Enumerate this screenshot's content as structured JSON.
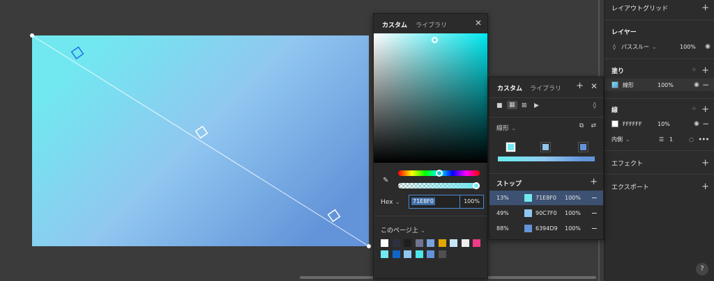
{
  "canvas": {
    "gradient": {
      "from": "#71E8F0",
      "mid": "#90C7F0",
      "to": "#6394D9"
    }
  },
  "right_panel": {
    "layout_grid": {
      "title": "レイアウトグリッド"
    },
    "layer": {
      "title": "レイヤー",
      "blend_mode": "パススルー",
      "opacity": "100%"
    },
    "fill": {
      "title": "塗り",
      "type": "線形",
      "opacity": "100%"
    },
    "stroke": {
      "title": "線",
      "hex": "FFFFFF",
      "opacity": "10%",
      "position": "内側",
      "weight": "1"
    },
    "effects": {
      "title": "エフェクト"
    },
    "export": {
      "title": "エクスポート"
    },
    "help": "?"
  },
  "color_picker": {
    "tabs": [
      "カスタム",
      "ライブラリ"
    ],
    "close_icon": "close-icon",
    "hex_label": "Hex",
    "hex_value": "71E8F0",
    "alpha": "100%",
    "page_colors_label": "このページ上",
    "swatches": [
      "#ffffff",
      "#2e3040",
      "#1e1e1e",
      "#6f7590",
      "#7aa3dc",
      "#e0a800",
      "#c7e6f5",
      "#eeeeee",
      "#f03a8a",
      "#71e8f0",
      "#1066c8",
      "#90c7f0",
      "#4de6ea",
      "#6394d9",
      "#505050"
    ]
  },
  "gradient_panel": {
    "tabs": [
      "カスタム",
      "ライブラリ"
    ],
    "gradient_type": "線形",
    "stops_label": "ストップ",
    "stops": [
      {
        "position": "13%",
        "hex": "71E8F0",
        "opacity": "100%",
        "color": "#71E8F0"
      },
      {
        "position": "49%",
        "hex": "90C7F0",
        "opacity": "100%",
        "color": "#90C7F0"
      },
      {
        "position": "88%",
        "hex": "6394D9",
        "opacity": "100%",
        "color": "#6394D9"
      }
    ]
  }
}
